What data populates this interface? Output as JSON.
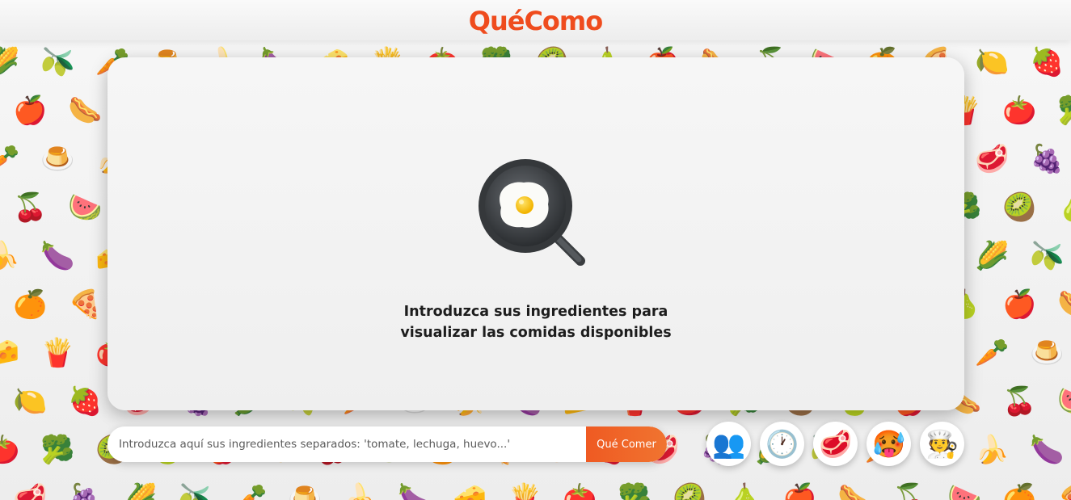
{
  "header": {
    "logo_text": "QuéComo"
  },
  "main_card": {
    "illustration_icon": "frying-pan-egg-icon",
    "message_line1": "Introduzca sus ingredientes para",
    "message_line2": "visualizar las comidas disponibles"
  },
  "search": {
    "placeholder": "Introduzca aquí sus ingredientes separados: 'tomate, lechuga, huevo...'",
    "value": "",
    "button_label": "Qué Comer"
  },
  "filters": [
    {
      "name": "people-filter",
      "icon": "people-icon",
      "glyph": "👥"
    },
    {
      "name": "time-filter",
      "icon": "clock-icon",
      "glyph": "🕐"
    },
    {
      "name": "meat-filter",
      "icon": "meat-icon",
      "glyph": "🥩"
    },
    {
      "name": "spicy-filter",
      "icon": "hot-face-icon",
      "glyph": "🥵"
    },
    {
      "name": "chef-filter",
      "icon": "chef-icon",
      "glyph": "🧑‍🍳"
    }
  ],
  "background_pattern": [
    "🌽",
    "🍓",
    "🍊",
    "🌭",
    "🥝",
    "🍟",
    "🍌",
    "🫒",
    "🥩",
    "🍕",
    "🍒",
    "🍐",
    "🍅",
    "🍆",
    "🥕",
    "🍇",
    "🍋",
    "🍉",
    "🍎",
    "🥦",
    "🧀",
    "🍮"
  ],
  "colors": {
    "brand": "#ef4c1e",
    "button": "#f06a2b"
  }
}
